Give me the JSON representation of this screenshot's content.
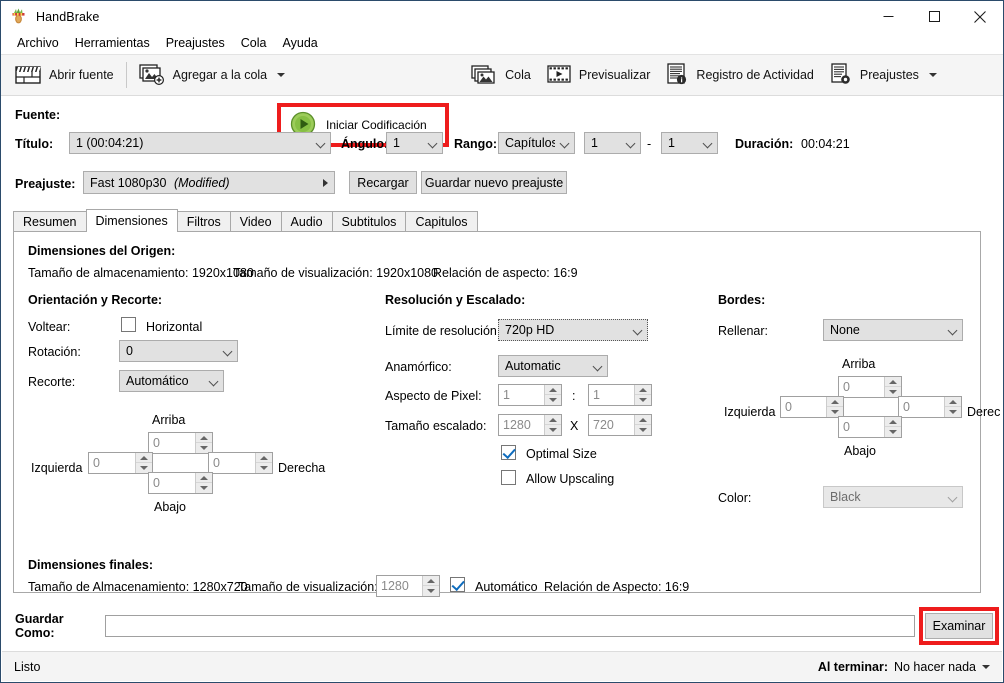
{
  "window": {
    "title": "HandBrake",
    "icon": "handbrake-pineapple-icon",
    "minimize": "minimize",
    "maximize": "maximize",
    "close": "close"
  },
  "menu": {
    "items": [
      {
        "label": "Archivo"
      },
      {
        "label": "Herramientas"
      },
      {
        "label": "Preajustes"
      },
      {
        "label": "Cola"
      },
      {
        "label": "Ayuda"
      }
    ]
  },
  "toolbar": {
    "open_source": "Abrir fuente",
    "add_to_queue": "Agregar a la cola",
    "start_encode": "Iniciar Codificación",
    "queue": "Cola",
    "preview": "Previsualizar",
    "activity_log": "Registro de Actividad",
    "presets": "Preajustes",
    "highlight_color": "#ee1c1c",
    "play_icon_color": "#8cc63f"
  },
  "source": {
    "source_label": "Fuente:",
    "title_label": "Título:",
    "title_value": "1  (00:04:21)",
    "angle_label": "Ángulo:",
    "angle_value": "1",
    "range_label": "Rango:",
    "range_value": "Capítulos",
    "range_start": "1",
    "range_dash": "-",
    "range_end": "1",
    "duration_label": "Duración:",
    "duration_value": "00:04:21"
  },
  "preset": {
    "label": "Preajuste:",
    "value": "Fast 1080p30",
    "modified": "(Modified)",
    "reload": "Recargar",
    "save_new": "Guardar nuevo preajuste"
  },
  "tabs": [
    {
      "label": "Resumen",
      "active": false
    },
    {
      "label": "Dimensiones",
      "active": true
    },
    {
      "label": "Filtros",
      "active": false
    },
    {
      "label": "Video",
      "active": false
    },
    {
      "label": "Audio",
      "active": false
    },
    {
      "label": "Subtitulos",
      "active": false
    },
    {
      "label": "Capitulos",
      "active": false
    }
  ],
  "dimensions": {
    "source_heading": "Dimensiones del Origen:",
    "source_storage": "Tamaño de almacenamiento: 1920x1080",
    "source_display": "Tamaño de visualización: 1920x1080",
    "source_aspect": "Relación de aspecto: 16:9",
    "orientation_heading": "Orientación y Recorte:",
    "flip_label": "Voltear:",
    "flip_horizontal": "Horizontal",
    "flip_checked": false,
    "rotation_label": "Rotación:",
    "rotation_value": "0",
    "crop_label": "Recorte:",
    "crop_value": "Automático",
    "crop_top_label": "Arriba",
    "crop_top": "0",
    "crop_left_label": "Izquierda",
    "crop_left": "0",
    "crop_right_label": "Derecha",
    "crop_right": "0",
    "crop_bottom_label": "Abajo",
    "crop_bottom": "0",
    "resolution_heading": "Resolución y Escalado:",
    "res_limit_label": "Límite de resolución:",
    "res_limit_value": "720p HD",
    "anamorphic_label": "Anamórfico:",
    "anamorphic_value": "Automatic",
    "pixel_aspect_label": "Aspecto de Pixel:",
    "pixel_aspect_num": "1",
    "pixel_aspect_sep": ":",
    "pixel_aspect_den": "1",
    "scaled_size_label": "Tamaño escalado:",
    "scaled_width": "1280",
    "scaled_sep": "X",
    "scaled_height": "720",
    "optimal_size_label": "Optimal Size",
    "optimal_size_checked": true,
    "allow_upscaling_label": "Allow Upscaling",
    "allow_upscaling_checked": false,
    "borders_heading": "Bordes:",
    "pad_label": "Rellenar:",
    "pad_value": "None",
    "pad_top_label": "Arriba",
    "pad_top": "0",
    "pad_left_label": "Izquierda",
    "pad_left": "0",
    "pad_right_label": "Derec",
    "pad_right": "0",
    "pad_bottom_label": "Abajo",
    "pad_bottom": "0",
    "color_label": "Color:",
    "color_value": "Black",
    "final_heading": "Dimensiones finales:",
    "final_storage": "Tamaño de Almacenamiento: 1280x720",
    "final_display_label": "Tamaño de visualización:",
    "final_display_value": "1280",
    "final_auto_label": "Automático",
    "final_auto_checked": true,
    "final_aspect": "Relación de Aspecto: 16:9"
  },
  "saveas": {
    "label": "Guardar Como:",
    "value": "",
    "browse": "Examinar",
    "highlight_color": "#ee1c1c"
  },
  "status": {
    "left": "Listo",
    "when_done_label": "Al terminar:",
    "when_done_value": "No hacer nada"
  }
}
